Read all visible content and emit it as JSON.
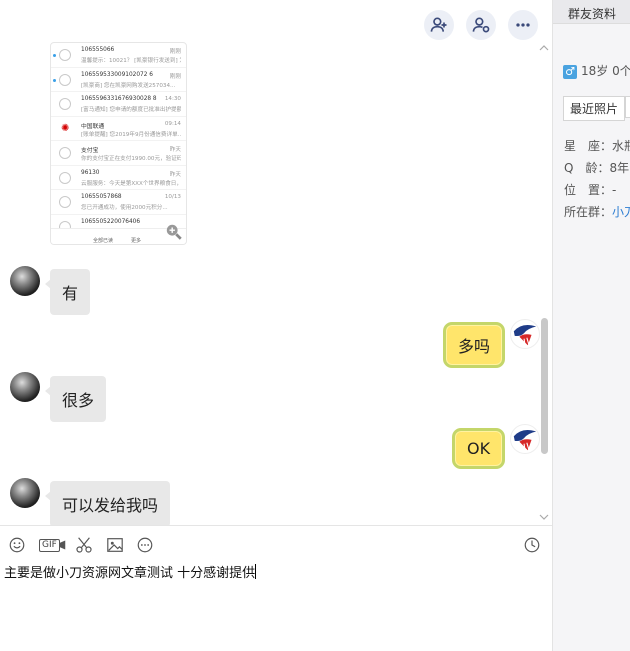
{
  "chat": {
    "screenshot": {
      "rows": [
        {
          "name": "106555066",
          "time": "刚刚",
          "sub": "温馨提示：10021？ [凯豪银行发送到] 为了...",
          "unread": true,
          "icon": "bell-icon"
        },
        {
          "name": "106559533009102072 6",
          "time": "刚刚",
          "sub": "[凯豪商] 您在凯豪网购发送257034...",
          "unread": true,
          "icon": "bell-icon"
        },
        {
          "name": "1065596331676930028 8",
          "time": "14:30",
          "sub": "[富马通知] 您申请的额度已批准出护提额...",
          "unread": false,
          "icon": "bell-icon"
        },
        {
          "name": "中国联通",
          "time": "09:14",
          "sub": "[账单提醒] 您2019年9月份通信费详单...",
          "unread": false,
          "icon": "unicom-icon"
        },
        {
          "name": "支付宝",
          "time": "昨天",
          "sub": "你的支付宝正在支付1990.00元，验证码891...",
          "unread": false,
          "icon": "bell-icon"
        },
        {
          "name": "96130",
          "time": "昨天",
          "sub": "云服服务：今天是第XXX个世界粮食日，去...",
          "unread": false,
          "icon": "bell-icon"
        },
        {
          "name": "10655057868",
          "time": "10/13",
          "sub": "您已开通成功，使用2000元积分...",
          "unread": false,
          "icon": "bell-icon"
        },
        {
          "name": "1065505220076406",
          "time": "",
          "sub": "",
          "unread": false,
          "icon": "bell-icon"
        }
      ],
      "bottom_left": "全部已读",
      "bottom_right": "更多"
    },
    "messages": [
      {
        "side": "in",
        "text": "有"
      },
      {
        "side": "out",
        "text": "多吗"
      },
      {
        "side": "in",
        "text": "很多"
      },
      {
        "side": "out",
        "text": "OK"
      },
      {
        "side": "in",
        "text": "可以发给我吗"
      }
    ]
  },
  "input": {
    "draft": "主要是做小刀资源网文章测试 十分感谢提供",
    "toolbar": [
      "smile-icon",
      "gif-icon",
      "scissors-icon",
      "image-icon",
      "more-icon",
      "history-icon"
    ],
    "gif_label": "GIF"
  },
  "panel": {
    "tab": "群友资料",
    "age_line": "18岁 0个",
    "recent_photos": "最近照片",
    "info": [
      {
        "label": "星　座：",
        "value": "水瓶"
      },
      {
        "label": "Q　龄：",
        "value": "8年"
      },
      {
        "label": "位　置：",
        "value": "-"
      },
      {
        "label": "所在群：",
        "value": "小刀"
      }
    ]
  },
  "colors": {
    "bubble_in": "#e8e8e8",
    "bubble_out": "#ffe56b",
    "bubble_out_border": "#c4d66a",
    "link": "#2d7dd2"
  }
}
